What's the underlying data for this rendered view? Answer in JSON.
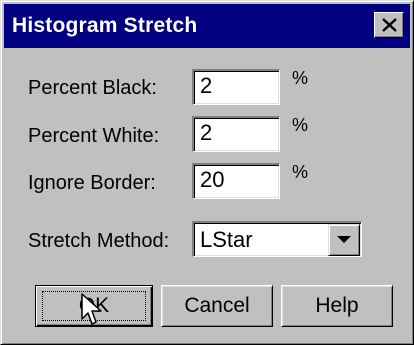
{
  "dialog": {
    "title": "Histogram Stretch"
  },
  "fields": {
    "percent_black": {
      "label": "Percent Black:",
      "value": "2",
      "unit": "%"
    },
    "percent_white": {
      "label": "Percent White:",
      "value": "2",
      "unit": "%"
    },
    "ignore_border": {
      "label": "Ignore Border:",
      "value": "20",
      "unit": "%"
    },
    "stretch_method": {
      "label": "Stretch Method:",
      "value": "LStar"
    }
  },
  "buttons": {
    "ok": "OK",
    "cancel": "Cancel",
    "help": "Help"
  },
  "icons": {
    "close": "close-icon",
    "dropdown": "chevron-down-icon",
    "cursor": "mouse-pointer-icon"
  },
  "colors": {
    "titlebar": "#000080",
    "face": "#c0c0c0"
  }
}
